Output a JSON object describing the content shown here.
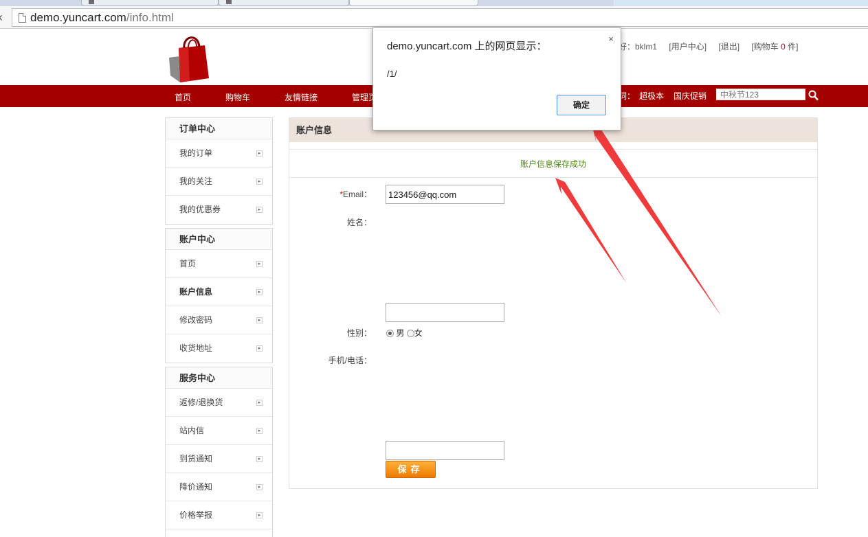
{
  "browser": {
    "url_host": "demo.yuncart.com",
    "url_path": "/info.html"
  },
  "header": {
    "greeting": "好：bklm1",
    "user_center": "[用户中心]",
    "logout": "[退出]",
    "cart_prefix": "[购物车 ",
    "cart_count": "0",
    "cart_suffix": " 件]"
  },
  "nav": {
    "items": [
      "首页",
      "购物车",
      "友情链接",
      "管理页"
    ],
    "hot_label": "词：",
    "hot_words": [
      "超极本",
      "国庆促销"
    ],
    "search_placeholder": "中秋节123"
  },
  "sidebar": {
    "groups": [
      {
        "title": "订单中心",
        "items": [
          "我的订单",
          "我的关注",
          "我的优惠券"
        ]
      },
      {
        "title": "账户中心",
        "items": [
          "首页",
          "账户信息",
          "修改密码",
          "收货地址"
        ]
      },
      {
        "title": "服务中心",
        "items": [
          "返修/退换货",
          "站内信",
          "到货通知",
          "降价通知",
          "价格举报"
        ]
      }
    ]
  },
  "main": {
    "title": "账户信息",
    "success": "账户信息保存成功",
    "email_label": "Email：",
    "email_required": "*",
    "email_value": "123456@qq.com",
    "name_label": "姓名：",
    "name_value": "",
    "gender_label": "性别：",
    "gender_male": "男",
    "gender_female": "女",
    "phone_label": "手机/电话：",
    "phone_value": "",
    "save_label": "保存"
  },
  "dialog": {
    "title": "demo.yuncart.com 上的网页显示：",
    "message": "/1/",
    "close": "×",
    "ok": "确定"
  },
  "colors": {
    "nav_bg": "#a50000",
    "panel_head_bg": "#ece3db",
    "success_text": "#4b8a10",
    "save_button": "#ef7a00",
    "annotation_arrow": "#ef3b3b"
  }
}
